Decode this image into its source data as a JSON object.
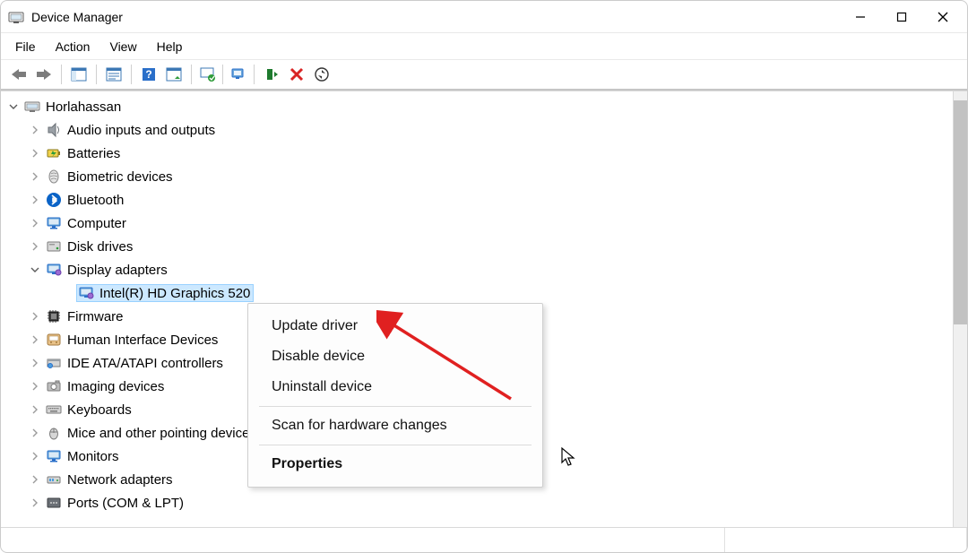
{
  "window": {
    "title": "Device Manager"
  },
  "menubar": {
    "items": [
      {
        "label": "File"
      },
      {
        "label": "Action"
      },
      {
        "label": "View"
      },
      {
        "label": "Help"
      }
    ]
  },
  "toolbar": {
    "buttons": {
      "back": "Back",
      "forward": "Forward",
      "show_hide_tree": "Show/Hide Console Tree",
      "properties": "Properties",
      "help": "Help",
      "update": "Update driver",
      "uninstall": "Uninstall device",
      "disable": "Disable device",
      "scan": "Scan for hardware changes",
      "add_hardware": "Add legacy hardware"
    }
  },
  "tree": {
    "root": {
      "label": "Horlahassan",
      "expanded": true
    },
    "nodes": [
      {
        "label": "Audio inputs and outputs",
        "icon": "speaker",
        "expanded": false
      },
      {
        "label": "Batteries",
        "icon": "battery",
        "expanded": false
      },
      {
        "label": "Biometric devices",
        "icon": "fingerprint",
        "expanded": false
      },
      {
        "label": "Bluetooth",
        "icon": "bluetooth",
        "expanded": false
      },
      {
        "label": "Computer",
        "icon": "monitor",
        "expanded": false
      },
      {
        "label": "Disk drives",
        "icon": "disk",
        "expanded": false
      },
      {
        "label": "Display adapters",
        "icon": "display",
        "expanded": true,
        "children": [
          {
            "label": "Intel(R) HD Graphics 520",
            "icon": "display",
            "selected": true
          }
        ]
      },
      {
        "label": "Firmware",
        "icon": "chip",
        "expanded": false
      },
      {
        "label": "Human Interface Devices",
        "icon": "hid",
        "expanded": false
      },
      {
        "label": "IDE ATA/ATAPI controllers",
        "icon": "ide",
        "expanded": false
      },
      {
        "label": "Imaging devices",
        "icon": "camera",
        "expanded": false
      },
      {
        "label": "Keyboards",
        "icon": "keyboard",
        "expanded": false
      },
      {
        "label": "Mice and other pointing devices",
        "icon": "mouse",
        "expanded": false
      },
      {
        "label": "Monitors",
        "icon": "monitor",
        "expanded": false
      },
      {
        "label": "Network adapters",
        "icon": "network",
        "expanded": false
      },
      {
        "label": "Ports (COM & LPT)",
        "icon": "port",
        "expanded": false
      }
    ]
  },
  "context_menu": {
    "items": [
      {
        "label": "Update driver"
      },
      {
        "label": "Disable device"
      },
      {
        "label": "Uninstall device"
      },
      {
        "separator": true
      },
      {
        "label": "Scan for hardware changes"
      },
      {
        "separator": true
      },
      {
        "label": "Properties",
        "bold": true
      }
    ]
  }
}
